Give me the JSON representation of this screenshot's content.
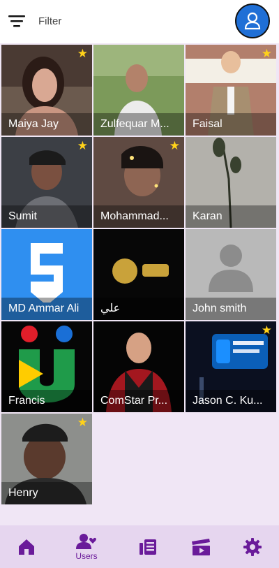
{
  "header": {
    "filter_label": "Filter"
  },
  "users": [
    {
      "name": "Maiya Jay",
      "starred": true
    },
    {
      "name": "Zulfequar M...",
      "starred": false
    },
    {
      "name": "Faisal",
      "starred": true
    },
    {
      "name": "Sumit",
      "starred": true
    },
    {
      "name": "Mohammad...",
      "starred": true
    },
    {
      "name": "Karan",
      "starred": false
    },
    {
      "name": "MD Ammar Ali",
      "starred": false
    },
    {
      "name": "علي",
      "starred": false
    },
    {
      "name": "John smith",
      "starred": false
    },
    {
      "name": "Francis",
      "starred": false
    },
    {
      "name": "ComStar Pr...",
      "starred": false
    },
    {
      "name": "Jason C. Ku...",
      "starred": true
    },
    {
      "name": "Henry",
      "starred": true
    }
  ],
  "bottom_nav": [
    {
      "icon": "home-icon",
      "label": ""
    },
    {
      "icon": "users-icon",
      "label": "Users"
    },
    {
      "icon": "posts-icon",
      "label": ""
    },
    {
      "icon": "videos-icon",
      "label": ""
    },
    {
      "icon": "settings-icon",
      "label": ""
    }
  ],
  "colors": {
    "accent": "#6a1b9a",
    "star": "#ffd21a",
    "avatar_bg": "#1f6fd6"
  }
}
